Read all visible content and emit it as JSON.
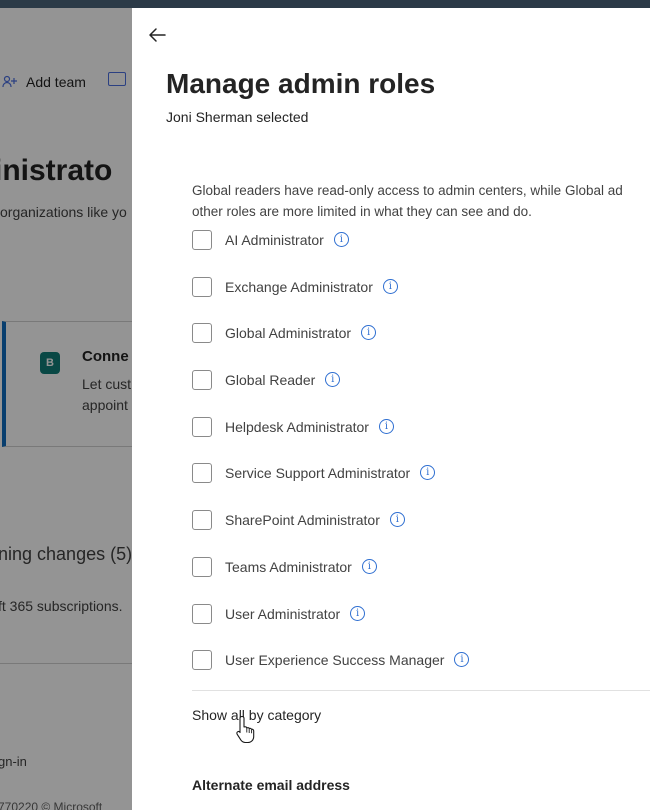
{
  "background": {
    "command_add_team": "Add team",
    "page_title": "inistrato",
    "page_subtitle": "organizations like yo",
    "card": {
      "logo_letter": "B",
      "title": "Conne",
      "desc_line1": "Let cust",
      "desc_line2": "appoint"
    },
    "pending_changes": "ning changes (5)",
    "subscriptions_text": "ft 365 subscriptions.",
    "sign_in_text": "gn-in",
    "footer_text": "770220 © Microsoft"
  },
  "panel": {
    "title": "Manage admin roles",
    "subtitle": "Joni Sherman selected",
    "description_line1": "Global readers have read-only access to admin centers, while Global ad",
    "description_line2": "other roles are more limited in what they can see and do.",
    "roles": [
      {
        "label": "AI Administrator",
        "checked": false
      },
      {
        "label": "Exchange Administrator",
        "checked": false
      },
      {
        "label": "Global Administrator",
        "checked": false
      },
      {
        "label": "Global Reader",
        "checked": false
      },
      {
        "label": "Helpdesk Administrator",
        "checked": false
      },
      {
        "label": "Service Support Administrator",
        "checked": false
      },
      {
        "label": "SharePoint Administrator",
        "checked": false
      },
      {
        "label": "Teams Administrator",
        "checked": false
      },
      {
        "label": "User Administrator",
        "checked": false
      },
      {
        "label": "User Experience Success Manager",
        "checked": false
      }
    ],
    "info_glyph": "i",
    "show_all_link": "Show all by category",
    "alternate_email_label": "Alternate email address"
  },
  "colors": {
    "accent": "#0f6cbd",
    "info_icon": "#2f6fd1",
    "top_bar": "#2b3a47"
  }
}
